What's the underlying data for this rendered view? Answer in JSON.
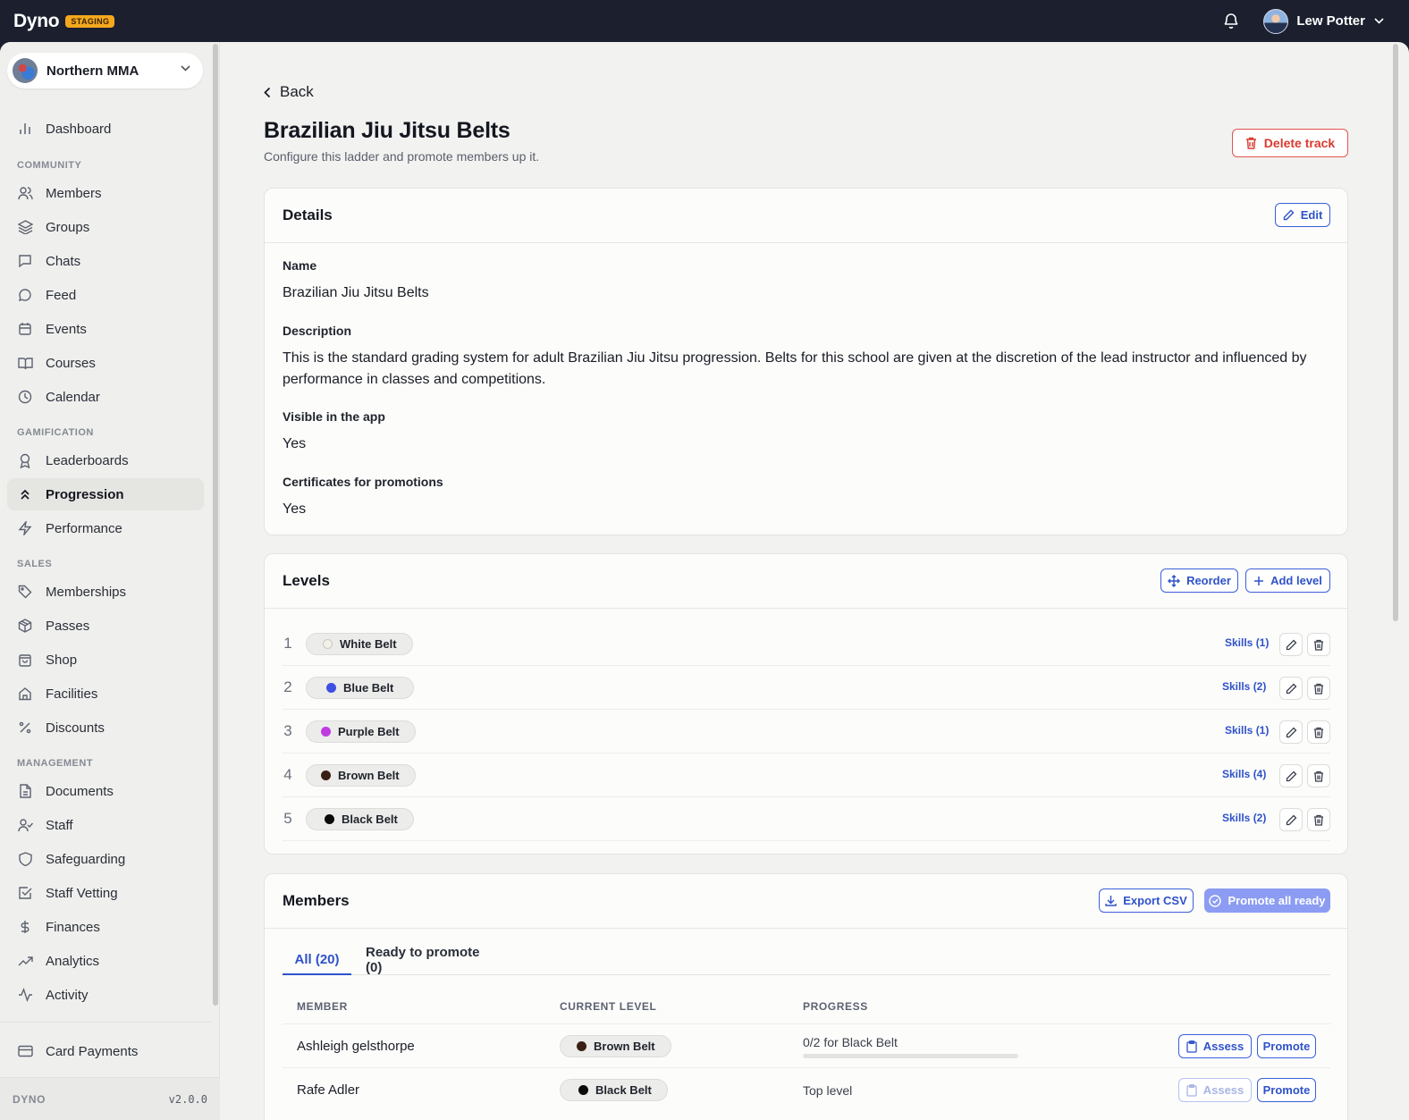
{
  "app": {
    "brand": "Dyno",
    "env": "STAGING",
    "version": "v2.0.0",
    "footer_name": "DYNO"
  },
  "user": {
    "name": "Lew Potter"
  },
  "org": {
    "name": "Northern MMA"
  },
  "sidebar": {
    "dashboard": "Dashboard",
    "sections": {
      "community": "COMMUNITY",
      "gamification": "GAMIFICATION",
      "sales": "SALES",
      "management": "MANAGEMENT"
    },
    "community": [
      "Members",
      "Groups",
      "Chats",
      "Feed",
      "Events",
      "Courses",
      "Calendar"
    ],
    "gamification": [
      "Leaderboards",
      "Progression",
      "Performance"
    ],
    "sales": [
      "Memberships",
      "Passes",
      "Shop",
      "Facilities",
      "Discounts"
    ],
    "management": [
      "Documents",
      "Staff",
      "Safeguarding",
      "Staff Vetting",
      "Finances",
      "Analytics",
      "Activity"
    ],
    "bottom": "Card Payments",
    "active": "Progression"
  },
  "page": {
    "back": "Back",
    "title": "Brazilian Jiu Jitsu Belts",
    "subtitle": "Configure this ladder and promote members up it.",
    "delete_label": "Delete track"
  },
  "details": {
    "title": "Details",
    "edit_label": "Edit",
    "name_label": "Name",
    "name_value": "Brazilian Jiu Jitsu Belts",
    "description_label": "Description",
    "description_value": "This is the standard grading system for adult Brazilian Jiu Jitsu progression. Belts for this school are given at the discretion of the lead instructor and influenced by performance in classes and competitions.",
    "visible_label": "Visible in the app",
    "visible_value": "Yes",
    "certificates_label": "Certificates for promotions",
    "certificates_value": "Yes"
  },
  "levels": {
    "title": "Levels",
    "reorder_label": "Reorder",
    "add_label": "Add level",
    "items": [
      {
        "num": "1",
        "name": "White Belt",
        "color": "#f1f1ea",
        "skills": "Skills (1)"
      },
      {
        "num": "2",
        "name": "Blue Belt",
        "color": "#3e4fe3",
        "skills": "Skills (2)"
      },
      {
        "num": "3",
        "name": "Purple Belt",
        "color": "#c03be0",
        "skills": "Skills (1)"
      },
      {
        "num": "4",
        "name": "Brown Belt",
        "color": "#3a1f14",
        "skills": "Skills (4)"
      },
      {
        "num": "5",
        "name": "Black Belt",
        "color": "#0b0b0b",
        "skills": "Skills (2)"
      }
    ]
  },
  "members": {
    "title": "Members",
    "export_label": "Export CSV",
    "promote_all_label": "Promote all ready",
    "tabs": [
      "All (20)",
      "Ready to promote (0)"
    ],
    "columns": [
      "MEMBER",
      "CURRENT LEVEL",
      "PROGRESS"
    ],
    "assess_label": "Assess",
    "promote_label": "Promote",
    "rows": [
      {
        "name": "Ashleigh gelsthorpe",
        "level": "Brown Belt",
        "level_color": "#3a1f14",
        "progress_text": "0/2 for Black Belt",
        "progress": 0
      },
      {
        "name": "Rafe Adler",
        "level": "Black Belt",
        "level_color": "#0b0b0b",
        "progress_text": "Top level"
      }
    ]
  }
}
